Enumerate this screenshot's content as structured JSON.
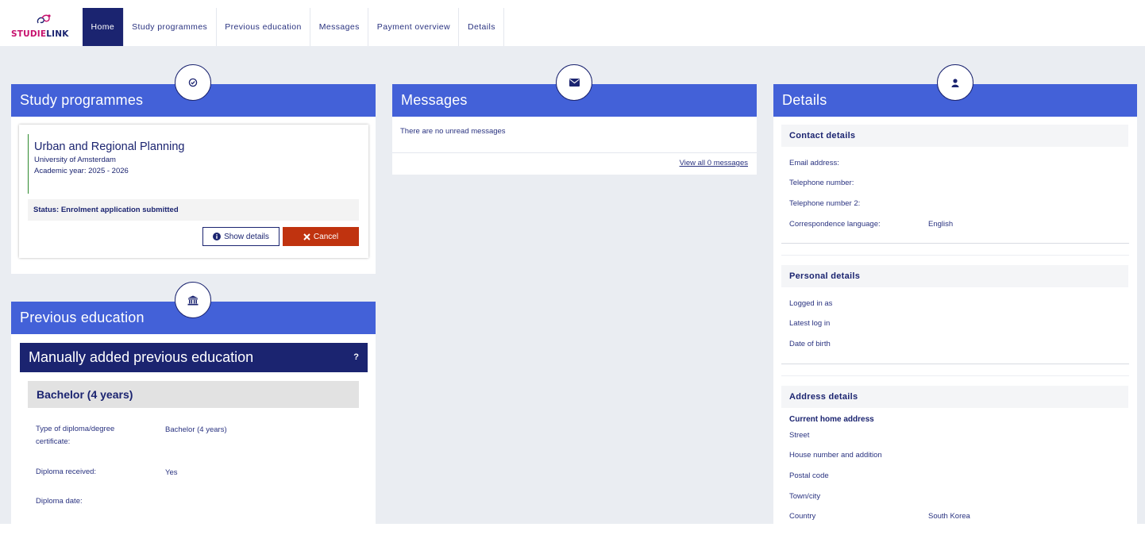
{
  "brand": {
    "logo_part1": "STUDIE",
    "logo_part2": "LINK",
    "pink": "#c7126e",
    "navy": "#1b2470"
  },
  "nav": {
    "tabs": [
      {
        "label": "Home",
        "active": true
      },
      {
        "label": "Study programmes",
        "active": false
      },
      {
        "label": "Previous education",
        "active": false
      },
      {
        "label": "Messages",
        "active": false
      },
      {
        "label": "Payment overview",
        "active": false
      },
      {
        "label": "Details",
        "active": false
      }
    ]
  },
  "colors": {
    "header_blue": "#4361d8",
    "dark_navy": "#1b2470",
    "cancel_red": "#c0330f",
    "page_bg": "#eaedf2",
    "status_green": "#2e8a2e"
  },
  "study": {
    "title": "Study programmes",
    "icon": "check-circle-icon",
    "programme": {
      "name": "Urban and Regional Planning",
      "university": "University of Amsterdam",
      "academic_year": "Academic year: 2025 - 2026",
      "status": "Status: Enrolment application submitted"
    },
    "show_details_label": "Show details",
    "cancel_label": "Cancel"
  },
  "previous_education": {
    "title": "Previous education",
    "icon": "institution-icon",
    "manual_title": "Manually added previous education",
    "help_mark": "?",
    "entry_title": "Bachelor (4 years)",
    "fields": [
      {
        "label": "Type of diploma/degree certificate:",
        "value": "Bachelor (4 years)"
      },
      {
        "label": "Diploma received:",
        "value": "Yes"
      },
      {
        "label": "Diploma date:",
        "value": ""
      }
    ]
  },
  "messages": {
    "title": "Messages",
    "icon": "envelope-icon",
    "empty_text": "There are no unread messages",
    "view_all": "View all 0 messages"
  },
  "details": {
    "title": "Details",
    "icon": "user-icon",
    "contact": {
      "heading": "Contact details",
      "rows": [
        {
          "label": "Email address:",
          "value": ""
        },
        {
          "label": "Telephone number:",
          "value": ""
        },
        {
          "label": "Telephone number 2:",
          "value": ""
        },
        {
          "label": "Correspondence language:",
          "value": "English"
        }
      ]
    },
    "personal": {
      "heading": "Personal details",
      "rows": [
        {
          "label": "Logged in as",
          "value": ""
        },
        {
          "label": "Latest log in",
          "value": ""
        },
        {
          "label": "Date of birth",
          "value": ""
        }
      ]
    },
    "address": {
      "heading": "Address details",
      "subheading": "Current home address",
      "rows": [
        {
          "label": "Street",
          "value": ""
        },
        {
          "label": "House number and addition",
          "value": ""
        },
        {
          "label": "Postal code",
          "value": ""
        },
        {
          "label": "Town/city",
          "value": ""
        },
        {
          "label": "Country",
          "value": "South Korea"
        }
      ]
    }
  }
}
